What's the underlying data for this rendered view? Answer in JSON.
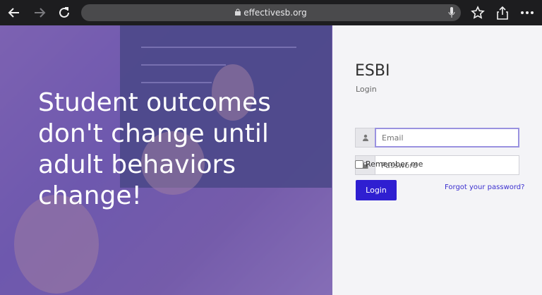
{
  "browser": {
    "url": "effectivesb.org",
    "icons": [
      "back-arrow-icon",
      "forward-arrow-icon",
      "reload-icon",
      "lock-icon",
      "mic-icon",
      "star-icon",
      "share-icon",
      "more-icon"
    ]
  },
  "hero": {
    "tagline": "Student outcomes don't change until adult behaviors change!"
  },
  "login": {
    "brand": "ESBI",
    "subtitle": "Login",
    "email_placeholder": "Email",
    "password_placeholder": "Password",
    "remember_label": "Remember me",
    "login_button": "Login",
    "forgot_link": "Forgot your password?"
  },
  "colors": {
    "accent": "#2f1fd1",
    "link": "#3b2fcf",
    "panel_bg": "#f4f4f7",
    "toolbar_bg": "#1d1d1f"
  }
}
